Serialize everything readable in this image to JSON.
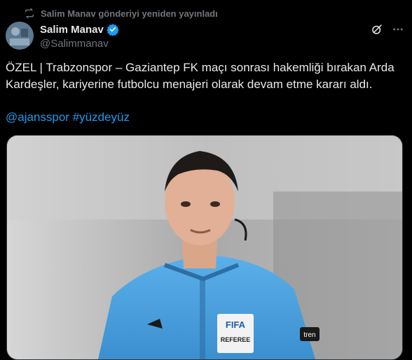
{
  "repost": {
    "text": "Salim Manav gönderiyi yeniden yayınladı",
    "icon": "repost-icon"
  },
  "author": {
    "name": "Salim Manav",
    "handle": "@Salimmanav",
    "verified": true
  },
  "post": {
    "text": "ÖZEL | Trabzonspor – Gaziantep FK maçı sonrası hakemliği bırakan Arda\nKardeşler, kariyerine futbolcu menajeri olarak devam etme kararı aldı.",
    "tags": [
      "@ajansspor",
      "#yüzdeyüz"
    ]
  },
  "media": {
    "badge_top": "FIFA",
    "badge_bottom": "REFEREE",
    "sleeve_text": "tren"
  },
  "colors": {
    "background": "#000000",
    "text": "#e7e9ea",
    "secondary": "#71767b",
    "accent": "#1d9bf0",
    "jersey": "#4aa3e0"
  }
}
